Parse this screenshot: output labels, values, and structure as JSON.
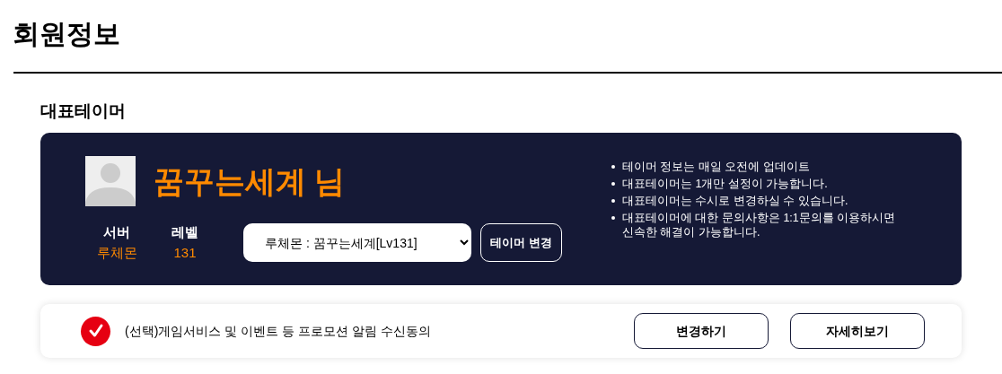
{
  "page_title": "회원정보",
  "section_title": "대표테이머",
  "tamer": {
    "name": "꿈꾸는세계 님",
    "server_label": "서버",
    "server": "루체몬",
    "level_label": "레벨",
    "level": "131",
    "select_value": "루체몬 : 꿈꾸는세계[Lv131]",
    "change_button": "테이머 변경"
  },
  "notes": [
    "테이머 정보는 매일 오전에 업데이트",
    "대표테이머는 1개만 설정이 가능합니다.",
    "대표테이머는 수시로 변경하실 수 있습니다.",
    "대표테이머에 대한 문의사항은 1:1문의를 이용하시면 신속한 해결이 가능합니다."
  ],
  "consent": {
    "checked": true,
    "label": "(선택)게임서비스 및 이벤트 등 프로모션 알림 수신동의",
    "buttons": [
      "변경하기",
      "자세히보기"
    ]
  }
}
